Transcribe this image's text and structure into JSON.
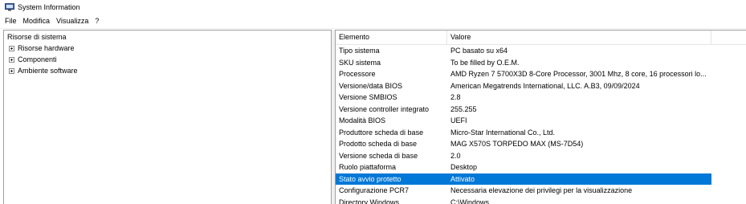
{
  "window": {
    "title": "System Information"
  },
  "menu": [
    "File",
    "Modifica",
    "Visualizza",
    "?"
  ],
  "tree": {
    "root": "Risorse di sistema",
    "items": [
      "Risorse hardware",
      "Componenti",
      "Ambiente software"
    ]
  },
  "list": {
    "columns": [
      "Elemento",
      "Valore"
    ],
    "rows": [
      {
        "elemento": "Tipo sistema",
        "valore": "PC basato su x64"
      },
      {
        "elemento": "SKU sistema",
        "valore": "To be filled by O.E.M."
      },
      {
        "elemento": "Processore",
        "valore": "AMD Ryzen 7 5700X3D 8-Core Processor, 3001 Mhz, 8 core, 16 processori lo..."
      },
      {
        "elemento": "Versione/data BIOS",
        "valore": "American Megatrends International, LLC. A.B3, 09/09/2024"
      },
      {
        "elemento": "Versione SMBIOS",
        "valore": "2.8"
      },
      {
        "elemento": "Versione controller integrato",
        "valore": "255.255"
      },
      {
        "elemento": "Modalità BIOS",
        "valore": "UEFI"
      },
      {
        "elemento": "Produttore scheda di base",
        "valore": "Micro-Star International Co., Ltd."
      },
      {
        "elemento": "Prodotto scheda di base",
        "valore": "MAG X570S TORPEDO MAX (MS-7D54)"
      },
      {
        "elemento": "Versione scheda di base",
        "valore": "2.0"
      },
      {
        "elemento": "Ruolo piattaforma",
        "valore": "Desktop"
      },
      {
        "elemento": "Stato avvio protetto",
        "valore": "Attivato"
      },
      {
        "elemento": "Configurazione PCR7",
        "valore": "Necessaria elevazione dei privilegi per la visualizzazione"
      },
      {
        "elemento": "Directory Windows",
        "valore": "C:\\Windows"
      }
    ],
    "selected_index": 11
  },
  "icons": {
    "app": "system-information-icon",
    "expander": "plus-expander-icon"
  },
  "colors": {
    "selection": "#0078d7",
    "border": "#a0a0a0"
  }
}
